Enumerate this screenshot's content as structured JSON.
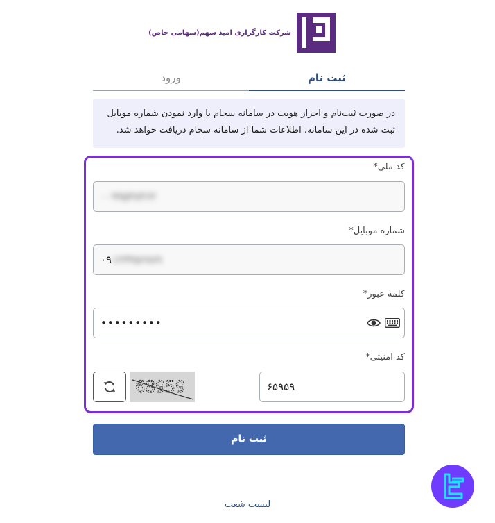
{
  "brand": {
    "name": "شرکت کارگزاری امید سهم(سهامی خاص)",
    "logo_icon": "omid-sahm-logo-icon",
    "logo_color": "#5b2b80"
  },
  "tabs": [
    {
      "label": "ثبت نام",
      "active": true
    },
    {
      "label": "ورود",
      "active": false
    }
  ],
  "info": {
    "line1": "در صورت ثبت‌نام و احراز هویت در سامانه سجام با وارد نمودن شماره موبایل",
    "line2": "ثبت شده در این سامانه، اطلاعات شما از سامانه سجام دریافت خواهد شد."
  },
  "form": {
    "national_code": {
      "label": "کد ملی*",
      "value": "۰۰۹۹۵۳۸۴۶۲"
    },
    "mobile": {
      "label": "شماره موبایل*",
      "prefix": "۰۹",
      "value": "۱۲۳۴۵۶۷۸۹"
    },
    "password": {
      "label": "کلمه عبور*",
      "value": "•••••••••"
    },
    "captcha": {
      "label": "کد امنیتی*",
      "value": "۶۵۹۵۹",
      "image_text": "68959"
    }
  },
  "submit_label": "ثبت نام",
  "branch_list_link": "لیست شعب",
  "colors": {
    "accent": "#4468ad",
    "frame": "#7a2fd0",
    "tab_active": "#2f4e7d",
    "info_bg": "#eeeffa"
  }
}
